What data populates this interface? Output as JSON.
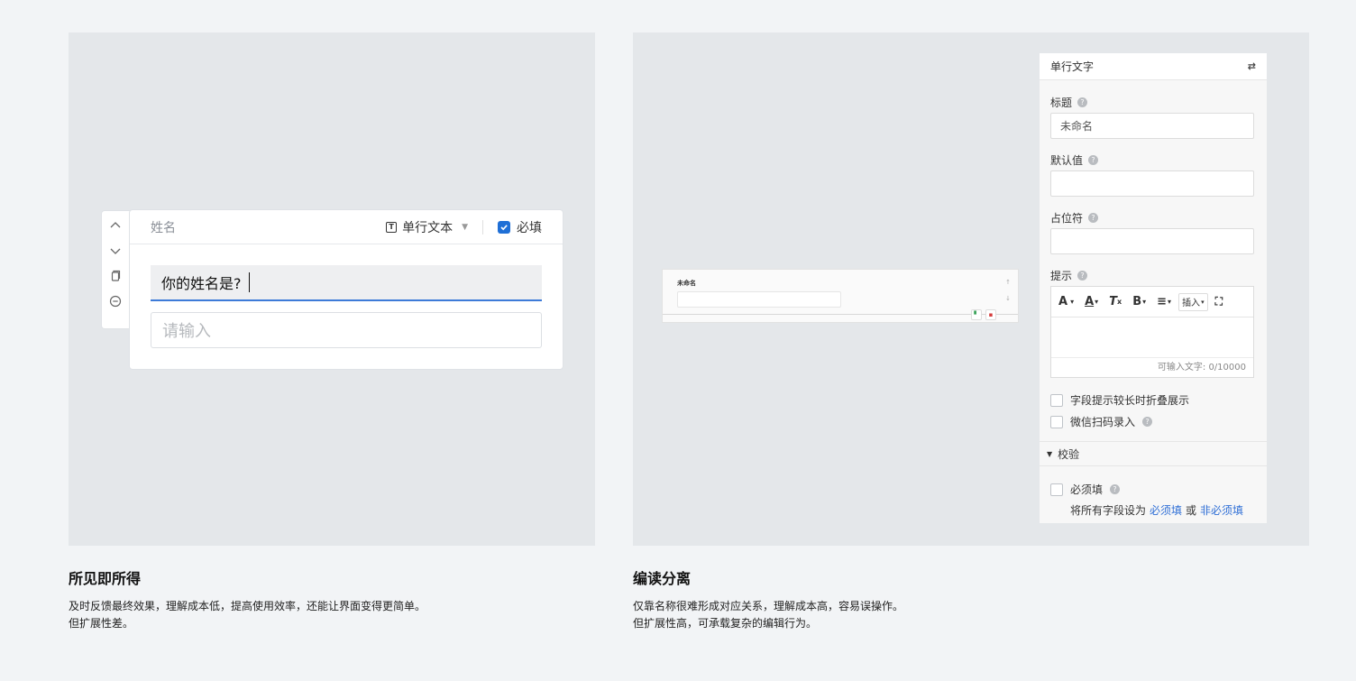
{
  "left_demo": {
    "field_name": "姓名",
    "type_label": "单行文本",
    "type_icon": "text-type-icon",
    "required_label": "必填",
    "required_checked": true,
    "question_value": "你的姓名是?",
    "answer_placeholder": "请输入",
    "side_tools": [
      "chevron-up-icon",
      "chevron-down-icon",
      "copy-icon",
      "remove-icon"
    ]
  },
  "right_demo": {
    "preview": {
      "field_label": "未命名"
    },
    "settings": {
      "header_title": "单行文字",
      "title_label": "标题",
      "title_value": "未命名",
      "default_label": "默认值",
      "default_value": "",
      "placeholder_label": "占位符",
      "placeholder_value": "",
      "hint_label": "提示",
      "toolbar": {
        "font": "A",
        "color": "A",
        "clear_format": "T",
        "bold": "B",
        "align": "≡",
        "insert": "插入"
      },
      "char_count": "可输入文字: 0/10000",
      "fold_hint_label": "字段提示较长时折叠展示",
      "wechat_scan_label": "微信扫码录入",
      "validation_section": "校验",
      "required_label": "必须填",
      "set_all_prefix": "将所有字段设为",
      "set_required_link": "必须填",
      "or_text": "或",
      "set_optional_link": "非必须填"
    }
  },
  "captions": {
    "left_title": "所见即所得",
    "left_line1": "及时反馈最终效果，理解成本低，提高使用效率，还能让界面变得更简单。",
    "left_line2": "但扩展性差。",
    "right_title": "编读分离",
    "right_line1": "仅靠名称很难形成对应关系，理解成本高，容易误操作。",
    "right_line2": "但扩展性高，可承载复杂的编辑行为。"
  },
  "colors": {
    "accent": "#2f6fd6",
    "panel_bg": "#e4e7ea",
    "page_bg": "#f2f4f6"
  }
}
